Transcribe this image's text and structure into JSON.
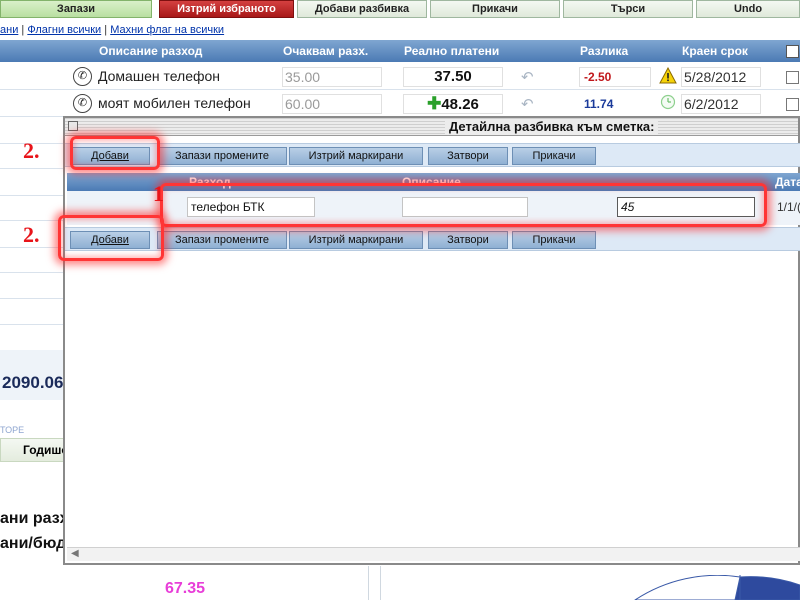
{
  "toolbar": {
    "save": "Запази",
    "delete_selected": "Изтрий избраното",
    "add_breakdown": "Добави разбивка",
    "attach": "Прикачи",
    "search": "Търси",
    "undo": "Undo"
  },
  "flag_links": {
    "partial": "ани",
    "sep1": " | ",
    "flag_all": "Флагни всички",
    "sep2": " | ",
    "unflag_all": "Махни флаг на всички"
  },
  "main_table": {
    "headers": {
      "description": "Описание разход",
      "expected": "Очаквам разх.",
      "paid": "Реално платени",
      "difference": "Разлика",
      "due": "Краен срок"
    },
    "rows": [
      {
        "icon": "phone-icon",
        "description": "Домашен телефон",
        "expected": "35.00",
        "paid": "37.50",
        "difference": "-2.50",
        "difference_color": "#c0161a",
        "status_icon": "warning-icon",
        "due": "5/28/2012"
      },
      {
        "icon": "phone-icon",
        "description": "моят мобилен телефон",
        "expected": "60.00",
        "paid": "48.26",
        "difference": "11.74",
        "difference_color": "#1a3a9a",
        "status_icon": "clock-icon",
        "due": "6/2/2012"
      }
    ]
  },
  "background": {
    "total": "2090.06",
    "small_text": "ТОРЕ",
    "yearly_button": "Годише",
    "heading_line1": "ани разх",
    "heading_line2": "ани/бюд",
    "value": "67.35"
  },
  "dialog": {
    "title": "Детайлна разбивка към сметка:",
    "buttons": {
      "add": "Добави",
      "save_changes": "Запази промените",
      "delete_marked": "Изтрий маркирани",
      "close": "Затвори",
      "attach": "Прикачи"
    },
    "columns": {
      "expense": "Разход",
      "description": "Описание",
      "date": "Дата"
    },
    "row": {
      "expense": "телефон БТК",
      "description": "",
      "amount": "45",
      "date": "1/1/("
    }
  },
  "annotations": {
    "step1": "1",
    "step2_top": "2.",
    "step2_bottom": "2."
  },
  "colors": {
    "header_blue": "#4b7ab4",
    "toolbar_green": "#b9dfa1",
    "delete_red": "#a81919",
    "annotation_red": "#e8141a",
    "value_magenta": "#e83ed8"
  }
}
